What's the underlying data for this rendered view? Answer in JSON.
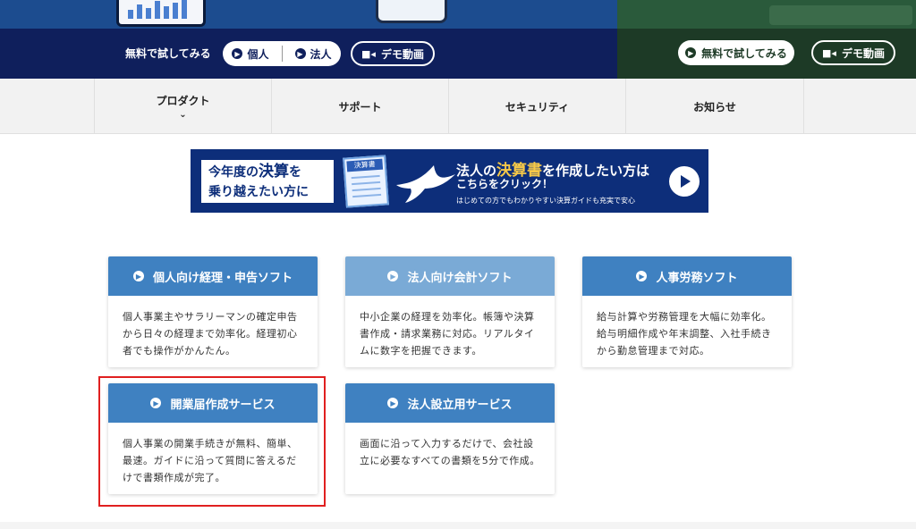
{
  "cta_left": {
    "label": "無料で試してみる",
    "individual": "個人",
    "corporate": "法人",
    "demo": "デモ動画"
  },
  "cta_right": {
    "trial": "無料で試してみる",
    "demo": "デモ動画"
  },
  "nav": {
    "items": [
      {
        "label": "プロダクト"
      },
      {
        "label": "サポート"
      },
      {
        "label": "セキュリティ"
      },
      {
        "label": "お知らせ"
      }
    ]
  },
  "banner": {
    "left_line1_a": "今年度の",
    "left_line1_b": "決算",
    "left_line1_c": "を",
    "left_line2": "乗り越えたい方に",
    "doc_title": "決算書",
    "headline_a": "法人の",
    "headline_b": "決算書",
    "headline_c": "を作成したい方は",
    "headline2": "こちらをクリック！",
    "sub": "はじめての方でもわかりやすい決算ガイドも充実で安心"
  },
  "cards": [
    {
      "title": "個人向け経理・申告ソフト",
      "body": "個人事業主やサラリーマンの確定申告から日々の経理まで効率化。経理初心者でも操作がかんたん。"
    },
    {
      "title": "法人向け会計ソフト",
      "body": "中小企業の経理を効率化。帳簿や決算書作成・請求業務に対応。リアルタイムに数字を把握できます。"
    },
    {
      "title": "人事労務ソフト",
      "body": "給与計算や労務管理を大幅に効率化。給与明細作成や年末調整、入社手続きから勤怠管理まで対応。"
    },
    {
      "title": "開業届作成サービス",
      "body": "個人事業の開業手続きが無料、簡単、最速。ガイドに沿って質問に答えるだけで書類作成が完了。"
    },
    {
      "title": "法人設立用サービス",
      "body": "画面に沿って入力するだけで、会社設立に必要なすべての書類を5分で作成。"
    }
  ],
  "colors": {
    "navy": "#0f1f5c",
    "green": "#1d3a26",
    "card_blue": "#3f81c1",
    "card_light": "#7aaad6",
    "highlight": "#e02020"
  }
}
